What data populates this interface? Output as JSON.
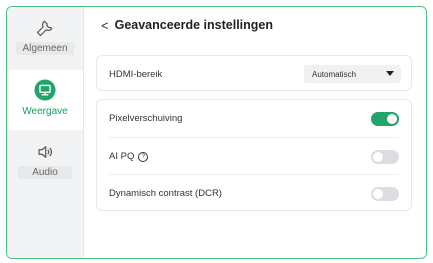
{
  "sidebar": {
    "items": [
      {
        "label": "Algemeen",
        "icon": "wrench-icon",
        "selected": false
      },
      {
        "label": "Weergave",
        "icon": "monitor-icon",
        "selected": true
      },
      {
        "label": "Audio",
        "icon": "speaker-icon",
        "selected": false
      }
    ]
  },
  "header": {
    "back_glyph": "<",
    "title": "Geavanceerde instellingen"
  },
  "settings": {
    "hdmi": {
      "label": "HDMI-bereik",
      "value": "Automatisch"
    },
    "pixel_shift": {
      "label": "Pixelverschuiving",
      "enabled": true
    },
    "ai_pq": {
      "label": "AI PQ",
      "help_glyph": "?",
      "enabled": false
    },
    "dcr": {
      "label": "Dynamisch contrast (DCR)",
      "enabled": false
    }
  },
  "colors": {
    "accent": "#22a56a",
    "toggle_off": "#dcdde0",
    "frame": "#4fbf86"
  }
}
